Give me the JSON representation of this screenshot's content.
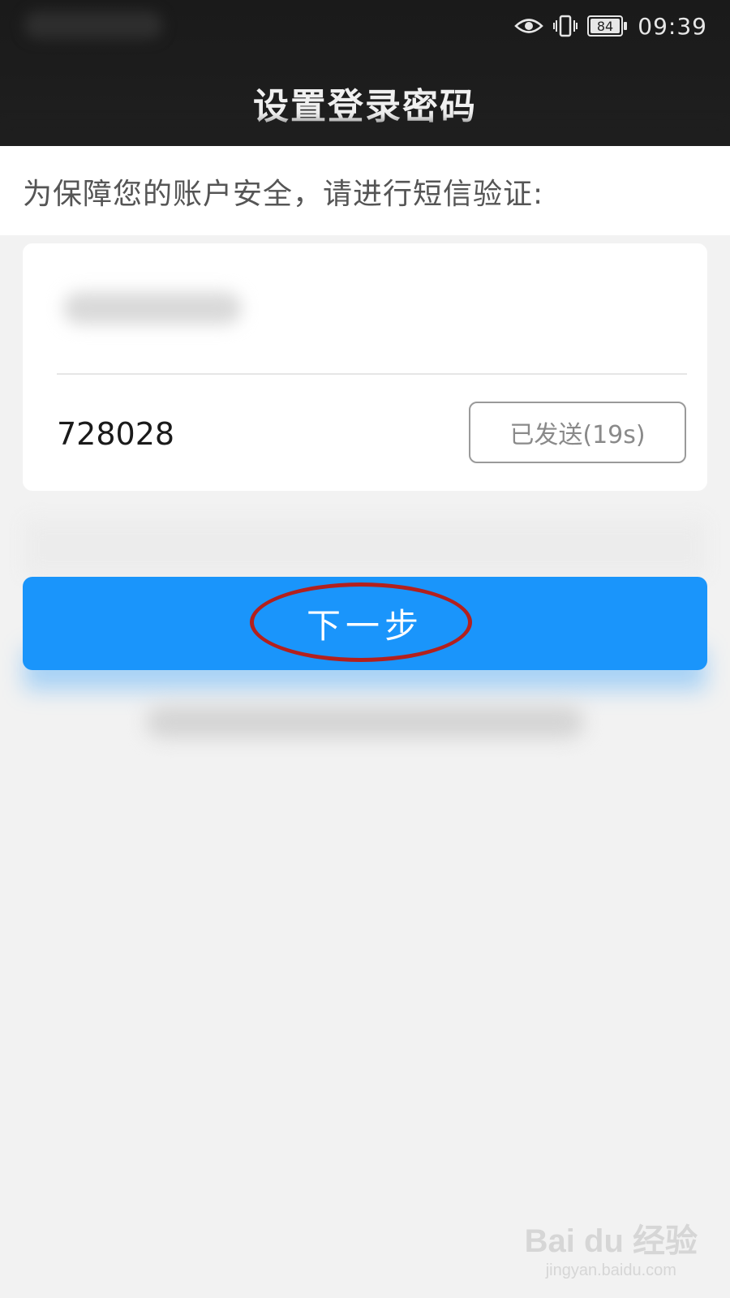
{
  "status_bar": {
    "time": "09:39",
    "battery": "84",
    "icons": [
      "eye-icon",
      "vibrate-icon",
      "battery-icon"
    ]
  },
  "header": {
    "title": "设置登录密码"
  },
  "main": {
    "notice": "为保障您的账户安全，请进行短信验证:",
    "code_value": "728028",
    "sent_label": "已发送(19s)",
    "next_label": "下一步"
  },
  "colors": {
    "header_bg": "#1c1c1c",
    "primary": "#1a95fb",
    "highlight": "#b3201d"
  },
  "watermark": {
    "main": "Bai du 经验",
    "sub": "jingyan.baidu.com"
  }
}
